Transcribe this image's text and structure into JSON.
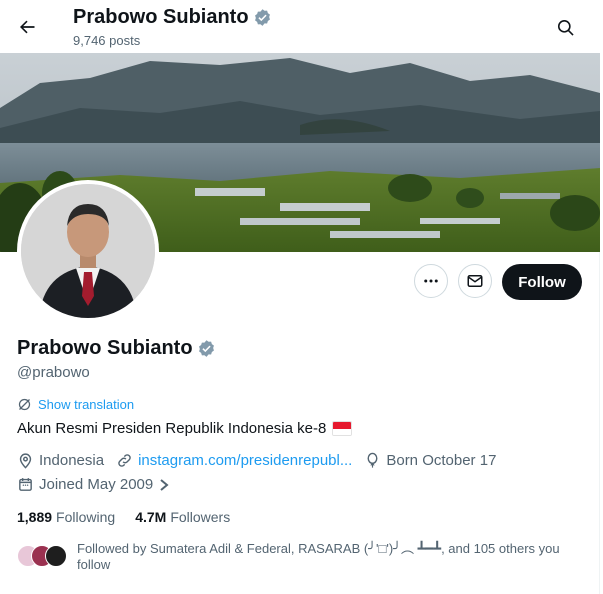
{
  "header": {
    "name": "Prabowo Subianto",
    "post_count": "9,746",
    "posts_label": "posts"
  },
  "profile": {
    "name": "Prabowo Subianto",
    "handle": "@prabowo",
    "show_translation": "Show translation",
    "bio": "Akun Resmi Presiden Republik Indonesia ke-8",
    "location": "Indonesia",
    "website": "instagram.com/presidenrepubl...",
    "born": "Born October 17",
    "joined": "Joined May 2009",
    "following_count": "1,889",
    "following_label": "Following",
    "followers_count": "4.7M",
    "followers_label": "Followers",
    "followed_by": "Followed by Sumatera Adil & Federal, RASARAB (╯'□')╯︵ ┻━┻, and 105 others you follow"
  },
  "actions": {
    "follow_label": "Follow"
  },
  "icons": {
    "back": "arrow-left-icon",
    "search": "search-icon",
    "verified": "verified-badge-icon",
    "more": "more-dots-icon",
    "message": "envelope-icon",
    "translate": "translate-icon",
    "location": "location-pin-icon",
    "link": "link-icon",
    "born": "balloon-icon",
    "calendar": "calendar-icon"
  },
  "colors": {
    "accent": "#1d9bf0",
    "text": "#0f1419",
    "muted": "#536471",
    "verified": "#829aab",
    "follow_bg": "#0f1419"
  }
}
